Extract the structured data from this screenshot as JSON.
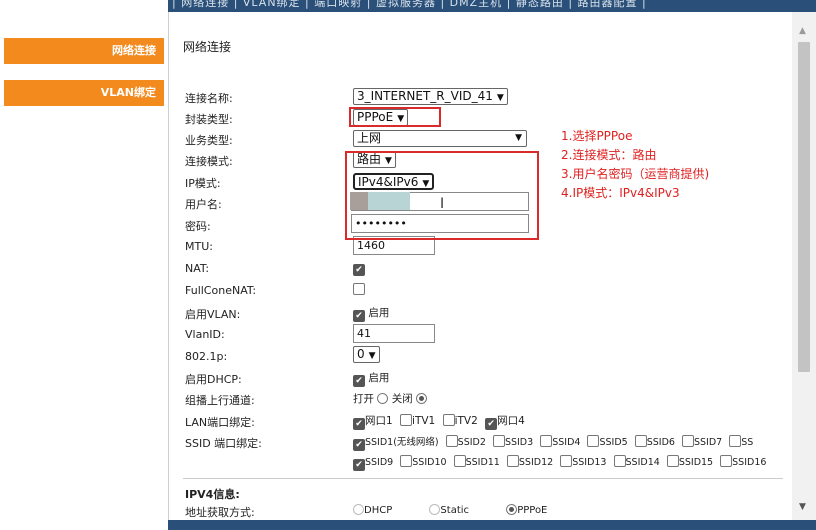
{
  "topnav": {
    "text": "| 网络连接 | VLAN绑定 | 端口映射 | 虚拟服务器 | DMZ主机 | 静态路由 | 路由器配置 |"
  },
  "sidebar": {
    "items": [
      {
        "label": "网络连接"
      },
      {
        "label": "VLAN绑定"
      }
    ]
  },
  "page": {
    "title": "网络连接"
  },
  "form": {
    "labels": {
      "conn_name": "连接名称:",
      "encap": "封装类型:",
      "service": "业务类型:",
      "conn_mode": "连接模式:",
      "ip_mode": "IP模式:",
      "username": "用户名:",
      "password": "密码:",
      "mtu": "MTU:",
      "nat": "NAT:",
      "fullcone": "FullConeNAT:",
      "vlan_enable": "启用VLAN:",
      "vlan_id": "VlanID:",
      "p8021": "802.1p:",
      "dhcp": "启用DHCP:",
      "multicast": "组播上行通道:",
      "lan_bind": "LAN端口绑定:",
      "ssid_bind": "SSID 端口绑定:"
    },
    "values": {
      "conn_name": "3_INTERNET_R_VID_41",
      "encap": "PPPoE",
      "service": "上网",
      "conn_mode": "路由",
      "ip_mode": "IPv4&IPv6",
      "password": "••••••••",
      "mtu": "1460",
      "vlan_id": "41",
      "p8021": "0"
    },
    "enable_label": "启用",
    "multicast": {
      "on": "打开",
      "off": "关闭"
    },
    "lan_ports": [
      "网口1",
      "iTV1",
      "iTV2",
      "网口4"
    ],
    "ssid_row1": [
      "SSID1(无线网络)",
      "SSID2",
      "SSID3",
      "SSID4",
      "SSID5",
      "SSID6",
      "SSID7",
      "SS"
    ],
    "ssid_row2": [
      "SSID9",
      "SSID10",
      "SSID11",
      "SSID12",
      "SSID13",
      "SSID14",
      "SSID15",
      "SSID16"
    ]
  },
  "annotations": [
    "1.选择PPPoe",
    "2.连接模式：路由",
    "3.用户名密码（运营商提供)",
    "4.IP模式：IPv4&IPv3"
  ],
  "ipv4": {
    "title": "IPV4信息:",
    "label": "地址获取方式:",
    "options": [
      "DHCP",
      "Static",
      "PPPoE"
    ]
  },
  "colors": {
    "accent": "#f28a1e",
    "nav": "#2a4f78",
    "annotation": "#e02020"
  }
}
